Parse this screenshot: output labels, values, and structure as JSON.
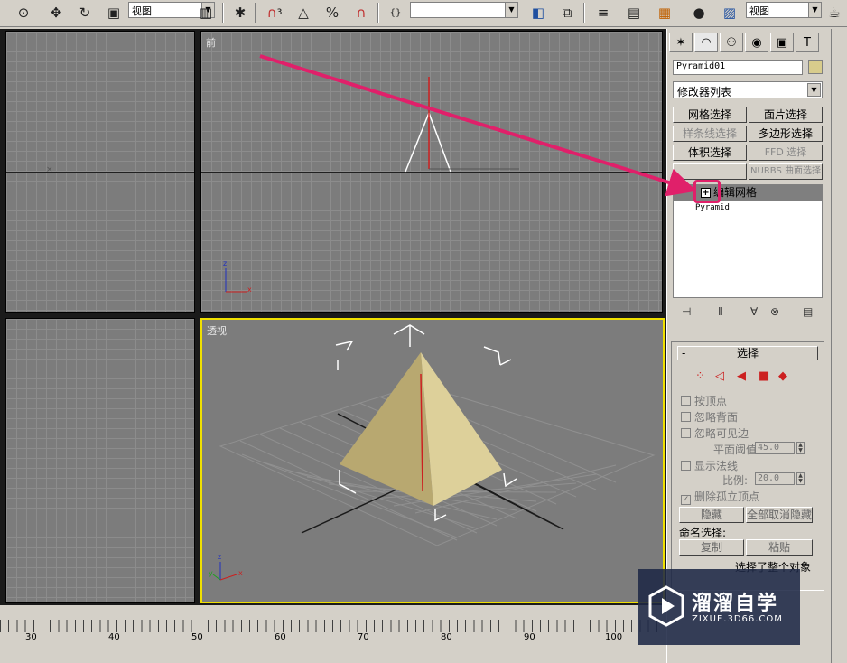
{
  "toolbar": {
    "view_select_1": "视图",
    "view_select_2": "视图",
    "snap_angle_label": "3",
    "icons": [
      "select-icon",
      "move-icon",
      "rotate-icon",
      "scale-icon",
      "link-icon",
      "run-icon",
      "snap-icon",
      "angle-snap-icon",
      "percent-snap-icon",
      "spinner-snap-icon",
      "text-icon",
      "mirror-icon",
      "align-icon",
      "layer-icon",
      "curve-editor-icon",
      "schematic-icon",
      "material-icon",
      "render-setup-icon",
      "render-icon"
    ]
  },
  "viewports": {
    "front_label": "前",
    "perspective_label": "透视",
    "axis_x": "x",
    "axis_y": "y",
    "axis_z": "z"
  },
  "ruler": {
    "ticks": [
      "30",
      "40",
      "50",
      "60",
      "70",
      "80",
      "90",
      "100"
    ]
  },
  "command_panel": {
    "object_name": "Pyramid01",
    "object_color": "#d8cc8c",
    "modifier_list": "修改器列表",
    "buttons": [
      {
        "label": "网格选择",
        "enabled": true
      },
      {
        "label": "面片选择",
        "enabled": true
      },
      {
        "label": "样条线选择",
        "enabled": false
      },
      {
        "label": "多边形选择",
        "enabled": true
      },
      {
        "label": "体积选择",
        "enabled": true
      },
      {
        "label": "FFD 选择",
        "enabled": false
      },
      {
        "label": "NURBS 曲面选择",
        "enabled": false
      }
    ],
    "stack": {
      "selected": "编辑网格",
      "base": "Pyramid"
    },
    "rollout": {
      "title": "选择",
      "by_vertex": "按顶点",
      "ignore_backfaces": "忽略背面",
      "ignore_visible_edges": "忽略可见边",
      "planar_threshold_label": "平面阈值:",
      "planar_threshold_value": "45.0",
      "show_normals": "显示法线",
      "scale_label": "比例:",
      "scale_value": "20.0",
      "delete_isolated": "删除孤立顶点",
      "hide": "隐藏",
      "unhide_all": "全部取消隐藏",
      "named_selections": "命名选择:",
      "copy": "复制",
      "paste": "粘贴",
      "status": "选择了整个对象"
    }
  },
  "watermark": {
    "title": "溜溜自学",
    "subtitle": "ZIXUE.3D66.COM"
  },
  "colors": {
    "annotation_arrow": "#e0206a",
    "pyramid_light": "#ddd09a",
    "pyramid_dark": "#b8a870",
    "active_viewport_border": "#f0e000"
  }
}
